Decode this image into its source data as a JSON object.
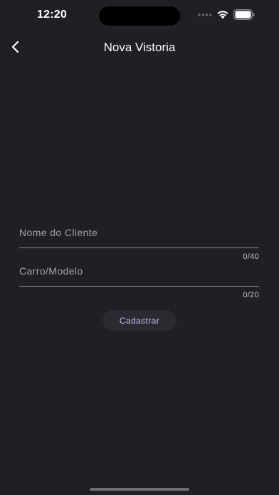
{
  "status_bar": {
    "time": "12:20"
  },
  "nav": {
    "title": "Nova Vistoria",
    "back_icon": "chevron-left-icon"
  },
  "form": {
    "client_name": {
      "placeholder": "Nome do Cliente",
      "value": "",
      "counter": "0/40"
    },
    "car_model": {
      "placeholder": "Carro/Modelo",
      "value": "",
      "counter": "0/20"
    },
    "submit_label": "Cadastrar"
  },
  "colors": {
    "background": "#201f24",
    "button_bg": "#2b2a30",
    "accent": "#cfbcff",
    "divider": "#8d8a91"
  }
}
